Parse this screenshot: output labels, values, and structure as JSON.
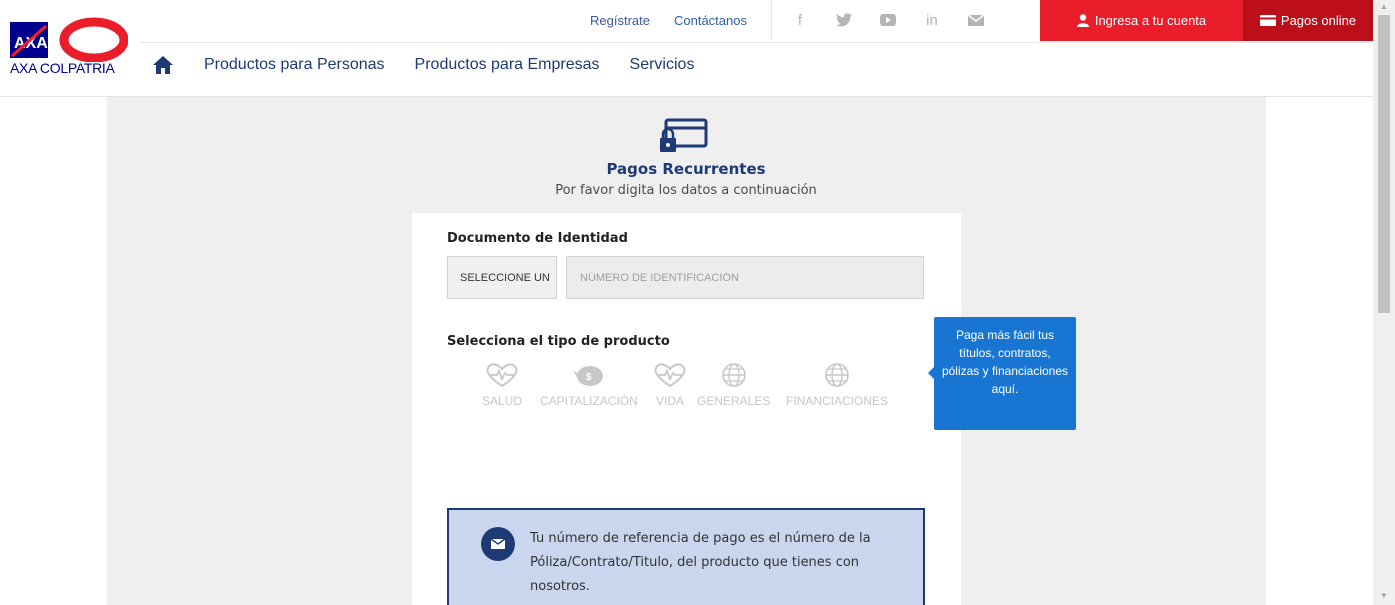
{
  "brand": {
    "logo_text": "AXA COLPATRIA"
  },
  "top_links": {
    "register": "Regístrate",
    "contact": "Contáctanos"
  },
  "social": {
    "facebook": "f",
    "twitter": "t",
    "youtube": "▶",
    "linkedin": "in",
    "email": "✉"
  },
  "buttons": {
    "login": "Ingresa a tu cuenta",
    "pay_online": "Pagos online"
  },
  "nav": {
    "items": [
      "Productos para Personas",
      "Productos para Empresas",
      "Servicios"
    ]
  },
  "page": {
    "title": "Pagos Recurrentes",
    "subtitle": "Por favor digita los datos a continuación"
  },
  "form": {
    "doc_label": "Documento de Identidad",
    "doc_select_value": "SELECCIONE UN",
    "doc_input_placeholder": "NÚMERO DE IDENTIFICACIÓN",
    "product_label": "Selecciona el tipo de producto",
    "products": [
      "SALUD",
      "CAPITALIZACIÓN",
      "VIDA",
      "GENERALES",
      "FINANCIACIONES"
    ]
  },
  "tooltip": {
    "text": "Paga más fácil tus títulos, contratos, pólizas y financiaciones aquí."
  },
  "info": {
    "text": "Tu número de referencia de pago es el número de la Póliza/Contrato/Titulo, del producto que tienes con nosotros."
  },
  "colors": {
    "brand_blue": "#1e3a74",
    "axa_red": "#ea1e2a",
    "dark_red": "#bd0f1a",
    "tooltip_blue": "#1875d1"
  }
}
